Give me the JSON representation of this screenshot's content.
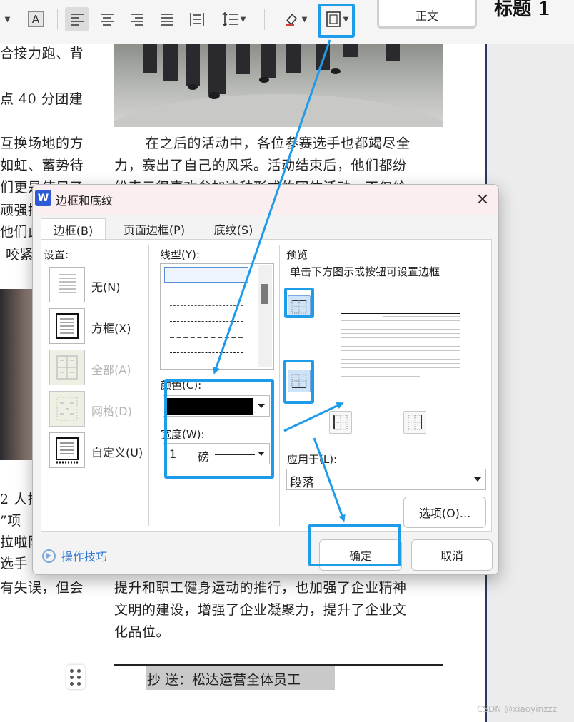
{
  "ribbon": {
    "font_color_glyph": "A",
    "style_normal": "正文",
    "style_heading": "标题 1",
    "icons": [
      "chevron-down-icon",
      "font-color-icon",
      "align-left-icon",
      "align-center-icon",
      "align-right-icon",
      "justify-icon",
      "distributed-icon",
      "line-spacing-icon",
      "shading-icon",
      "border-icon"
    ]
  },
  "document": {
    "left_column": [
      "合接力跑、背",
      "点 40 分团建",
      "互换场地的方",
      "如虹、蓄势待",
      "们更是使足了",
      "顽强拼",
      "他们此",
      "咬紧",
      "2 人搭",
      "”项",
      "拉啦队",
      "选手",
      "有失误，但会"
    ],
    "main_lines": [
      "在之后的活动中，各位参赛选手也都竭尽全",
      "力，赛出了自己的风采。活动结束后，他们都纷",
      "纷表示很喜欢参加这种形式的团体活动，不仅给"
    ],
    "after_dialog_lines": [
      "提升和职工健身运动的推行，也加强了企业精神",
      "文明的建设，增强了企业凝聚力，提升了企业文",
      "化品位。"
    ],
    "cc_line": "抄  送：松达运营全体员工",
    "watermark": "CSDN @xiaoyinzzz"
  },
  "dialog": {
    "title": "边框和底纹",
    "app_icon": "W",
    "close": "✕",
    "tabs": [
      "边框(B)",
      "页面边框(P)",
      "底纹(S)"
    ],
    "settings_label": "设置:",
    "settings": [
      {
        "label": "无(N)",
        "enabled": true
      },
      {
        "label": "方框(X)",
        "enabled": true
      },
      {
        "label": "全部(A)",
        "enabled": false
      },
      {
        "label": "网格(D)",
        "enabled": false
      },
      {
        "label": "自定义(U)",
        "enabled": true
      }
    ],
    "line_style_label": "线型(Y):",
    "line_styles": [
      "solid",
      "dotted",
      "dashed",
      "dashed-long",
      "dash-dot",
      "dash-dot-dot"
    ],
    "color_label": "颜色(C):",
    "color_value": "#000000",
    "width_label": "宽度(W):",
    "width_value": "1",
    "width_unit": "磅",
    "preview_label": "预览",
    "preview_hint": "单击下方图示或按钮可设置边框",
    "apply_label": "应用于(L):",
    "apply_value": "段落",
    "options_button": "选项(O)...",
    "ok_button": "确定",
    "cancel_button": "取消",
    "tips_link": "操作技巧"
  },
  "colors": {
    "highlight": "#1e9be9",
    "link": "#2f7ad6",
    "title_bar": "#fbeef0"
  }
}
